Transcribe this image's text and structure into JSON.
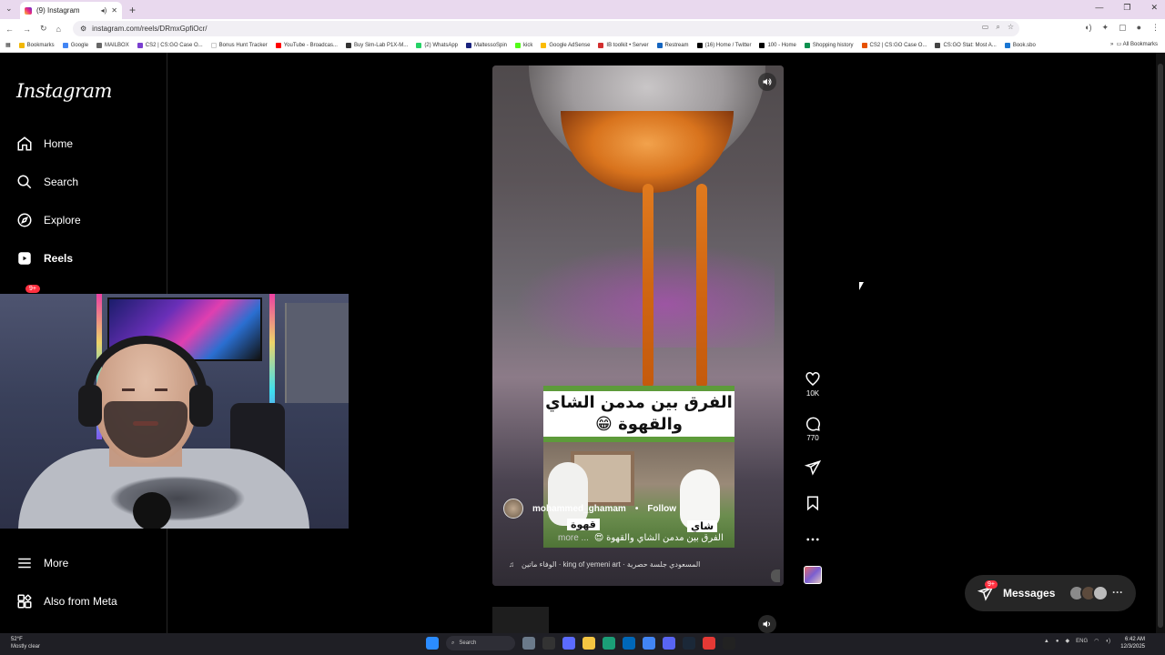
{
  "browser": {
    "tab_title": "(9) Instagram",
    "url": "instagram.com/reels/DRmxGpfiOcr/",
    "bookmarks": [
      "Bookmarks",
      "Google",
      "MAILBOX",
      "CS2 | CS:GO Case O...",
      "Bonus Hunt Tracker",
      "YouTube - Broadcas...",
      "Buy Sim-Lab P1X-M...",
      "(2) WhatsApp",
      "MaltessoSpin",
      "kick",
      "Google AdSense",
      "IB toolkit • Server",
      "Restream",
      "(16) Home / Twitter",
      "100 - Home",
      "Shopping history",
      "CS2 | CS:GO Case O...",
      "CS:GO Stat: Most A...",
      "Book.sbo"
    ],
    "all_bookmarks": "All Bookmarks"
  },
  "sidebar": {
    "logo": "Instagram",
    "items": [
      {
        "label": "Home",
        "icon": "home-icon"
      },
      {
        "label": "Search",
        "icon": "search-icon"
      },
      {
        "label": "Explore",
        "icon": "compass-icon"
      },
      {
        "label": "Reels",
        "icon": "reels-icon"
      }
    ],
    "badge": "9+",
    "more": "More",
    "also_from_meta": "Also from Meta"
  },
  "reel": {
    "caption_title": "الفرق بين مدمن الشاي والقهوة 😁",
    "inset_label_left": "قهوة",
    "inset_label_right": "شاي",
    "author": "mohammed_ghamam",
    "follow": "Follow",
    "description": "الفرق بين مدمن الشاي والقهوة 😍",
    "more": "more ...",
    "audio": "الوفاء ماتين · king of yemeni art · المسعودي جلسة حصرية"
  },
  "actions": {
    "likes": "10K",
    "comments": "770"
  },
  "messages": {
    "label": "Messages",
    "badge": "9+"
  },
  "taskbar": {
    "temp": "52°F",
    "weather": "Mostly clear",
    "search": "Search",
    "lang": "ENG",
    "time": "6:42 AM",
    "date": "12/3/2025"
  }
}
